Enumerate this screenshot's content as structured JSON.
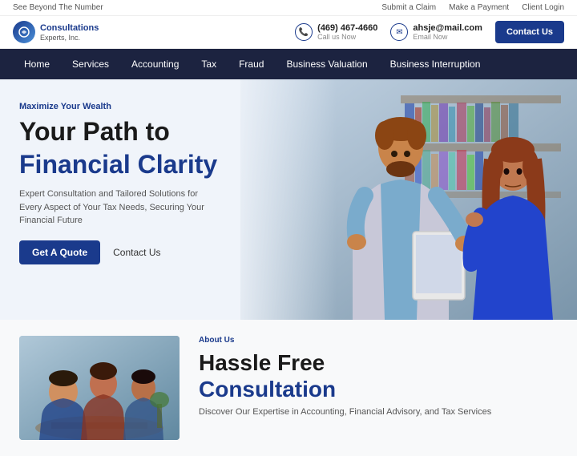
{
  "topBar": {
    "tagline": "See Beyond The Number",
    "links": [
      "Submit a Claim",
      "Make a Payment",
      "Client Login"
    ]
  },
  "header": {
    "logoLine1": "Consultations",
    "logoLine2": "Experts, Inc.",
    "phone": {
      "number": "(469) 467-4660",
      "label": "Call us Now"
    },
    "email": {
      "address": "ahsje@mail.com",
      "label": "Email Now"
    },
    "contactBtn": "Contact Us"
  },
  "nav": {
    "items": [
      "Home",
      "Services",
      "Accounting",
      "Tax",
      "Fraud",
      "Business Valuation",
      "Business Interruption"
    ]
  },
  "hero": {
    "tag": "Maximize Your Wealth",
    "titleLine1": "Your Path to",
    "titleLine2": "Financial Clarity",
    "description": "Expert Consultation and Tailored Solutions for Every Aspect of Your Tax Needs, Securing Your Financial Future",
    "btnQuote": "Get A Quote",
    "btnContact": "Contact Us"
  },
  "bottom": {
    "tag": "About Us",
    "titleLine1": "Hassle Free",
    "titleLine2": "Consultation",
    "description": "Discover Our Expertise in Accounting, Financial Advisory, and Tax Services"
  }
}
